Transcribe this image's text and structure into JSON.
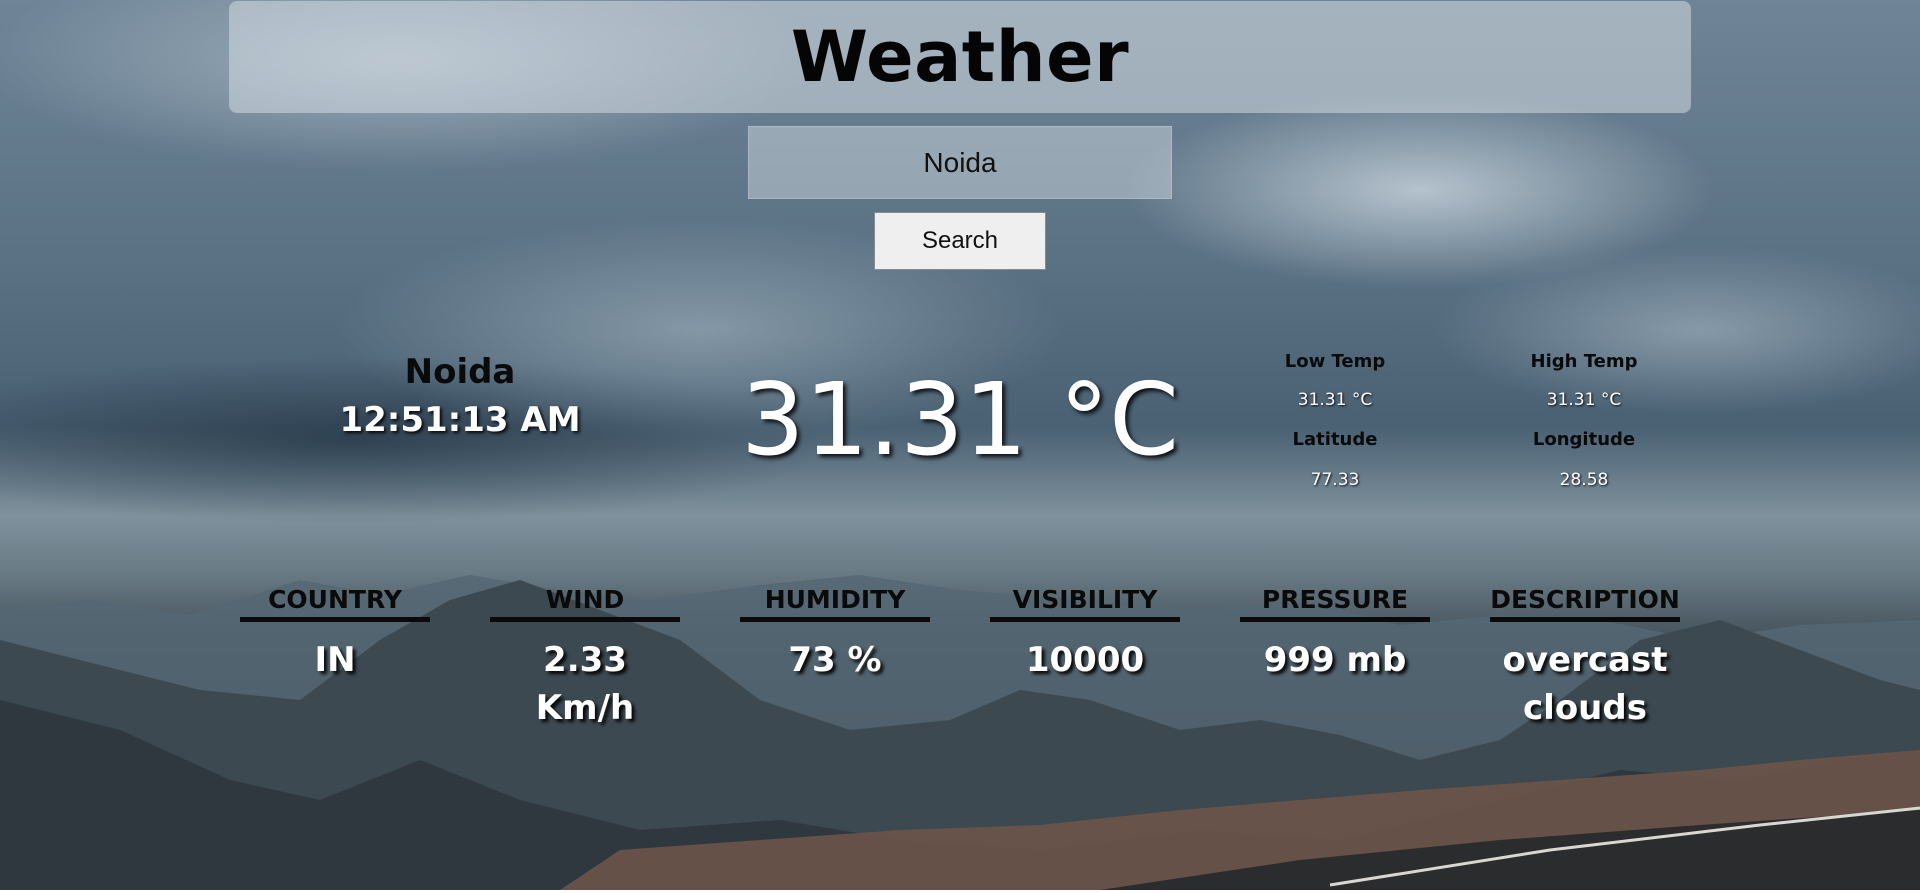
{
  "header": {
    "title": "Weather"
  },
  "search": {
    "value": "Noida",
    "button_label": "Search"
  },
  "location": {
    "city": "Noida",
    "time": "12:51:13 AM"
  },
  "current": {
    "temperature": "31.31 °C"
  },
  "stats": {
    "low_temp": {
      "label": "Low Temp",
      "value": "31.31 °C"
    },
    "high_temp": {
      "label": "High Temp",
      "value": "31.31 °C"
    },
    "latitude": {
      "label": "Latitude",
      "value": "77.33"
    },
    "longitude": {
      "label": "Longitude",
      "value": "28.58"
    }
  },
  "metrics": [
    {
      "label": "COUNTRY",
      "value": "IN"
    },
    {
      "label": "WIND",
      "value": "2.33 Km/h"
    },
    {
      "label": "HUMIDITY",
      "value": "73 %"
    },
    {
      "label": "VISIBILITY",
      "value": "10000"
    },
    {
      "label": "PRESSURE",
      "value": "999 mb"
    },
    {
      "label": "DESCRIPTION",
      "value": "overcast clouds"
    }
  ]
}
